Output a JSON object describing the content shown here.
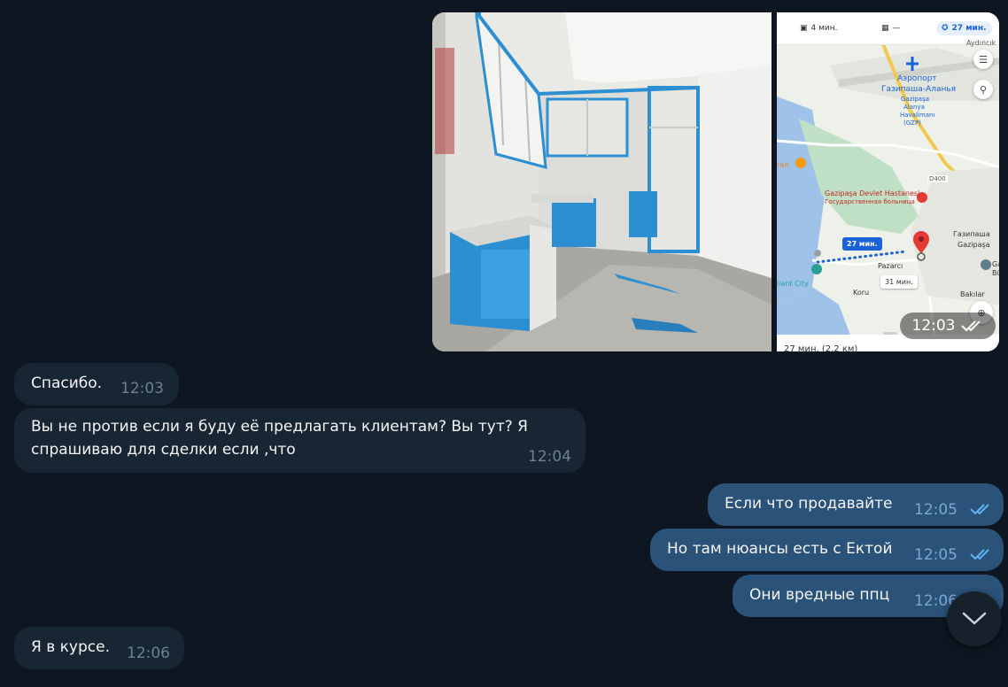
{
  "album": {
    "time": "12:03",
    "map": {
      "mode_car_label": "4 мин.",
      "mode_transit_label": "—",
      "mode_walk_label": "27 мин.",
      "place_aydincik": "Aydıncık",
      "airport_ru": "Аэропорт",
      "airport_ru2": "Газипаша-Аланья",
      "airport_tr1": "Gazipaşa",
      "airport_tr2": "Alanya",
      "airport_tr3": "Havalimanı",
      "airport_code": "(GZP)",
      "road_d400": "D400",
      "hospital_tr": "Gazipaşa Devlet Hastanesi",
      "hospital_ru": "Государственная больница",
      "route_time": "27 мин.",
      "alt_route_time": "31 мин.",
      "town_ru": "Газипаша",
      "town_tr": "Gazipaşa",
      "pazarci": "Pazarcı",
      "koru": "Koru",
      "bakilar": "Bakılar",
      "client_city": "lient City",
      "restaurant_fragment": "ran",
      "gaz": "Gaz",
      "buy": "Büy",
      "bottom_fragment": "27 мин. (2,2 км)"
    }
  },
  "messages": [
    {
      "side": "in",
      "text": [
        "Спасибо."
      ],
      "time": "12:03"
    },
    {
      "side": "in",
      "text": [
        "Вы не против если я буду её предлагать клиентам? Вы тут? Я",
        "спрашиваю для сделки если ,что"
      ],
      "time": "12:04"
    },
    {
      "side": "out",
      "text": [
        "Если что продавайте"
      ],
      "time": "12:05",
      "read": true
    },
    {
      "side": "out",
      "text": [
        "Но там нюансы есть с Ектой"
      ],
      "time": "12:05",
      "read": true
    },
    {
      "side": "out",
      "text": [
        "Они вредные ппц"
      ],
      "time": "12:06",
      "read": true
    },
    {
      "side": "in",
      "text": [
        "Я в курсе."
      ],
      "time": "12:06"
    }
  ],
  "colors": {
    "background": "#0e1621",
    "incoming_bubble": "#182533",
    "outgoing_bubble": "#2b5278",
    "read_ticks": "#5fb3f0"
  },
  "icons": {
    "read_receipt": "double-check-icon",
    "scroll_down": "chevron-down-icon",
    "map_layers": "layers-icon",
    "map_search": "search-icon",
    "map_locate": "locate-icon"
  }
}
